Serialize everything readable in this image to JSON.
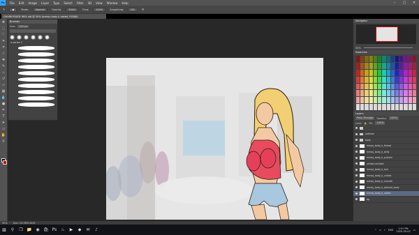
{
  "titlebar": {
    "app_badge": "Ps",
    "menus": [
      "File",
      "Edit",
      "Image",
      "Layer",
      "Type",
      "Select",
      "Filter",
      "3D",
      "View",
      "Window",
      "Help"
    ]
  },
  "options": {
    "mode_label": "Mode:",
    "mode_value": "Normal",
    "opacity_label": "Opacity:",
    "opacity_value": "100%",
    "flow_label": "Flow:",
    "flow_value": "100%",
    "smoothing_label": "Smoothing:",
    "smoothing_value": "0%"
  },
  "document": {
    "tab_title": "GH486 READY 96% old @ 50% (messy body k naked, RGB/8)"
  },
  "brushes_panel": {
    "title": "Brushes",
    "size_label": "Size:",
    "size_value": "101 px",
    "group_name": "e-series 1"
  },
  "navigator": {
    "title": "Navigator",
    "zoom": "50%"
  },
  "swatches": {
    "title": "Swatches"
  },
  "layers": {
    "title": "Layers",
    "blend": "Pass Through",
    "opacity_label": "Opacity:",
    "opacity_value": "100%",
    "lock_label": "Lock:",
    "fill_label": "Fill:",
    "fill_value": "100%",
    "items": [
      {
        "name": "",
        "type": "folder"
      },
      {
        "name": "outlines",
        "type": "folder"
      },
      {
        "name": "body",
        "type": "folder"
      },
      {
        "name": "messy_body_k_thread",
        "type": "layer"
      },
      {
        "name": "messy_body_k_belly",
        "type": "layer"
      },
      {
        "name": "messy_body_k_pushed",
        "type": "layer"
      },
      {
        "name": "yellow neckfwd",
        "type": "layer"
      },
      {
        "name": "messy_body_k_hair",
        "type": "layer"
      },
      {
        "name": "messy_body_k_undies",
        "type": "layer"
      },
      {
        "name": "messy_body_k_vmouth",
        "type": "layer"
      },
      {
        "name": "messy_body_k_sleeved_body",
        "type": "layer"
      },
      {
        "name": "messy_body_k_naked",
        "type": "layer",
        "selected": true
      },
      {
        "name": "bg",
        "type": "layer"
      }
    ]
  },
  "status": {
    "zoom": "50%",
    "doc_size": "Doc: 24.3M/1.60G"
  },
  "taskbar": {
    "time": "2:51 PM",
    "date": "2020-09-02",
    "lang": "ENG"
  }
}
